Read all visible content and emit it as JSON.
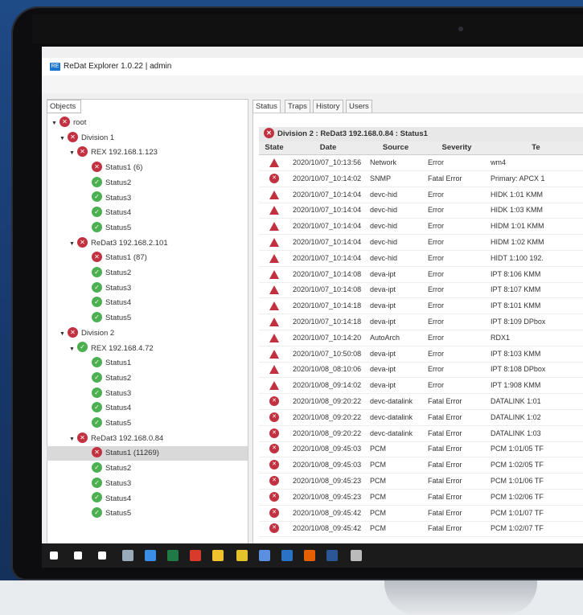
{
  "app": {
    "title": "ReDat Explorer 1.0.22 | admin",
    "icon_label": "RE"
  },
  "left_panel": {
    "tab": "Objects"
  },
  "tree": [
    {
      "label": "root",
      "status": "red",
      "level": 0,
      "arrow": true
    },
    {
      "label": "Division 1",
      "status": "red",
      "level": 1,
      "arrow": true
    },
    {
      "label": "REX 192.168.1.123",
      "status": "red",
      "level": 2,
      "arrow": true
    },
    {
      "label": "Status1 (6)",
      "status": "red",
      "level": 3
    },
    {
      "label": "Status2",
      "status": "green",
      "level": 3
    },
    {
      "label": "Status3",
      "status": "green",
      "level": 3
    },
    {
      "label": "Status4",
      "status": "green",
      "level": 3
    },
    {
      "label": "Status5",
      "status": "green",
      "level": 3
    },
    {
      "label": "ReDat3 192.168.2.101",
      "status": "red",
      "level": 2,
      "arrow": true
    },
    {
      "label": "Status1 (87)",
      "status": "red",
      "level": 3
    },
    {
      "label": "Status2",
      "status": "green",
      "level": 3
    },
    {
      "label": "Status3",
      "status": "green",
      "level": 3
    },
    {
      "label": "Status4",
      "status": "green",
      "level": 3
    },
    {
      "label": "Status5",
      "status": "green",
      "level": 3
    },
    {
      "label": "Division 2",
      "status": "red",
      "level": 1,
      "arrow": true
    },
    {
      "label": "REX 192.168.4.72",
      "status": "green",
      "level": 2,
      "arrow": true
    },
    {
      "label": "Status1",
      "status": "green",
      "level": 3
    },
    {
      "label": "Status2",
      "status": "green",
      "level": 3
    },
    {
      "label": "Status3",
      "status": "green",
      "level": 3
    },
    {
      "label": "Status4",
      "status": "green",
      "level": 3
    },
    {
      "label": "Status5",
      "status": "green",
      "level": 3
    },
    {
      "label": "ReDat3 192.168.0.84",
      "status": "red",
      "level": 2,
      "arrow": true
    },
    {
      "label": "Status1 (11269)",
      "status": "red",
      "level": 3,
      "selected": true
    },
    {
      "label": "Status2",
      "status": "green",
      "level": 3
    },
    {
      "label": "Status3",
      "status": "green",
      "level": 3
    },
    {
      "label": "Status4",
      "status": "green",
      "level": 3
    },
    {
      "label": "Status5",
      "status": "green",
      "level": 3
    }
  ],
  "tabs": [
    "Status",
    "Traps",
    "History",
    "Users"
  ],
  "active_tab": "Status",
  "panel_header": "Division 2 : ReDat3 192.168.0.84 : Status1",
  "columns": [
    "State",
    "Date",
    "Source",
    "Severity",
    "Te"
  ],
  "rows": [
    {
      "state": "warn",
      "date": "2020/10/07_10:13:56",
      "source": "Network",
      "severity": "Error",
      "text": "wm4"
    },
    {
      "state": "fatal",
      "date": "2020/10/07_10:14:02",
      "source": "SNMP",
      "severity": "Fatal Error",
      "text": "Primary: APCX 1"
    },
    {
      "state": "warn",
      "date": "2020/10/07_10:14:04",
      "source": "devc-hid",
      "severity": "Error",
      "text": "HIDK 1:01 KMM"
    },
    {
      "state": "warn",
      "date": "2020/10/07_10:14:04",
      "source": "devc-hid",
      "severity": "Error",
      "text": "HIDK 1:03 KMM"
    },
    {
      "state": "warn",
      "date": "2020/10/07_10:14:04",
      "source": "devc-hid",
      "severity": "Error",
      "text": "HIDM 1:01 KMM"
    },
    {
      "state": "warn",
      "date": "2020/10/07_10:14:04",
      "source": "devc-hid",
      "severity": "Error",
      "text": "HIDM 1:02 KMM"
    },
    {
      "state": "warn",
      "date": "2020/10/07_10:14:04",
      "source": "devc-hid",
      "severity": "Error",
      "text": "HIDT 1:100 192."
    },
    {
      "state": "warn",
      "date": "2020/10/07_10:14:08",
      "source": "deva-ipt",
      "severity": "Error",
      "text": "IPT 8:106 KMM"
    },
    {
      "state": "warn",
      "date": "2020/10/07_10:14:08",
      "source": "deva-ipt",
      "severity": "Error",
      "text": "IPT 8:107 KMM"
    },
    {
      "state": "warn",
      "date": "2020/10/07_10:14:18",
      "source": "deva-ipt",
      "severity": "Error",
      "text": "IPT 8:101 KMM"
    },
    {
      "state": "warn",
      "date": "2020/10/07_10:14:18",
      "source": "deva-ipt",
      "severity": "Error",
      "text": "IPT 8:109 DPbox"
    },
    {
      "state": "warn",
      "date": "2020/10/07_10:14:20",
      "source": "AutoArch",
      "severity": "Error",
      "text": "RDX1"
    },
    {
      "state": "warn",
      "date": "2020/10/07_10:50:08",
      "source": "deva-ipt",
      "severity": "Error",
      "text": "IPT 8:103 KMM"
    },
    {
      "state": "warn",
      "date": "2020/10/08_08:10:06",
      "source": "deva-ipt",
      "severity": "Error",
      "text": "IPT 8:108 DPbox"
    },
    {
      "state": "warn",
      "date": "2020/10/08_09:14:02",
      "source": "deva-ipt",
      "severity": "Error",
      "text": "IPT 1:908 KMM"
    },
    {
      "state": "fatal",
      "date": "2020/10/08_09:20:22",
      "source": "devc-datalink",
      "severity": "Fatal Error",
      "text": "DATALINK 1:01"
    },
    {
      "state": "fatal",
      "date": "2020/10/08_09:20:22",
      "source": "devc-datalink",
      "severity": "Fatal Error",
      "text": "DATALINK 1:02"
    },
    {
      "state": "fatal",
      "date": "2020/10/08_09:20:22",
      "source": "devc-datalink",
      "severity": "Fatal Error",
      "text": "DATALINK 1:03"
    },
    {
      "state": "fatal",
      "date": "2020/10/08_09:45:03",
      "source": "PCM",
      "severity": "Fatal Error",
      "text": "PCM 1:01/05 TF"
    },
    {
      "state": "fatal",
      "date": "2020/10/08_09:45:03",
      "source": "PCM",
      "severity": "Fatal Error",
      "text": "PCM 1:02/05 TF"
    },
    {
      "state": "fatal",
      "date": "2020/10/08_09:45:23",
      "source": "PCM",
      "severity": "Fatal Error",
      "text": "PCM 1:01/06 TF"
    },
    {
      "state": "fatal",
      "date": "2020/10/08_09:45:23",
      "source": "PCM",
      "severity": "Fatal Error",
      "text": "PCM 1:02/06 TF"
    },
    {
      "state": "fatal",
      "date": "2020/10/08_09:45:42",
      "source": "PCM",
      "severity": "Fatal Error",
      "text": "PCM 1:01/07 TF"
    },
    {
      "state": "fatal",
      "date": "2020/10/08_09:45:42",
      "source": "PCM",
      "severity": "Fatal Error",
      "text": "PCM 1:02/07 TF"
    }
  ],
  "taskbar_icons": [
    {
      "name": "windows-start-icon",
      "color": "#ffffff"
    },
    {
      "name": "search-icon",
      "color": "#ffffff"
    },
    {
      "name": "task-view-icon",
      "color": "#ffffff"
    },
    {
      "name": "network-app-icon",
      "color": "#9ab"
    },
    {
      "name": "ie-browser-icon",
      "color": "#3a8ee6"
    },
    {
      "name": "excel-icon",
      "color": "#1f7a45"
    },
    {
      "name": "todo-app-icon",
      "color": "#d83b2b"
    },
    {
      "name": "file-explorer-icon",
      "color": "#f2c12e"
    },
    {
      "name": "chrome-icon",
      "color": "#e3c22b"
    },
    {
      "name": "save-app-icon",
      "color": "#5b8fe0"
    },
    {
      "name": "outlook-icon",
      "color": "#2a72c4"
    },
    {
      "name": "firefox-icon",
      "color": "#e66000"
    },
    {
      "name": "word-icon",
      "color": "#2b5797"
    },
    {
      "name": "tool-app-icon",
      "color": "#bbbbbb"
    }
  ]
}
